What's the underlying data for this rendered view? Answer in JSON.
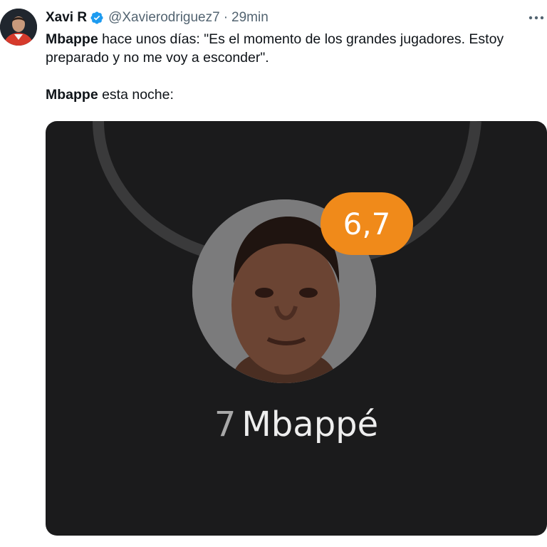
{
  "tweet": {
    "author": {
      "display_name": "Xavi R",
      "handle": "@Xavierodriguez7",
      "avatar_icon": "user-avatar-icon",
      "verified_icon": "verified-badge-icon"
    },
    "separator": "·",
    "timestamp": "29min",
    "more_icon": "more-options-icon",
    "text": {
      "line1_bold": "Mbappe",
      "line1_rest": " hace unos días:  \"Es el momento de los grandes jugadores. Estoy preparado y no me voy a esconder\".",
      "line2_bold": "Mbappe",
      "line2_rest": " esta noche:"
    },
    "media": {
      "rating": "6,7",
      "player_number": "7",
      "player_name": "Mbappé"
    }
  },
  "colors": {
    "verified_blue": "#1d9bf0",
    "rating_orange": "#f08a1a",
    "media_background": "#1b1b1c",
    "secondary_text": "#536471"
  }
}
